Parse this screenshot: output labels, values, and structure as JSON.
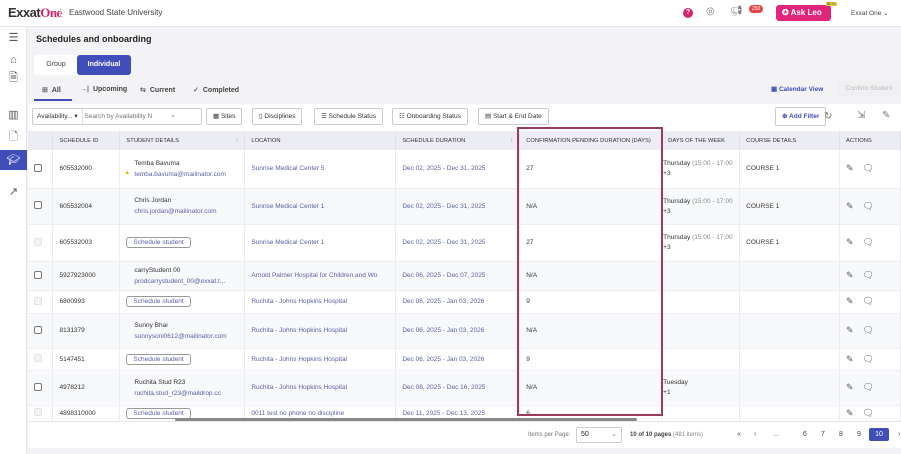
{
  "header": {
    "logo_main": "Exxat",
    "logo_accent": "One",
    "university": "Eastwood State University",
    "notification_count": "250",
    "ask_leo": "Ask Leo",
    "ask_leo_badge": "BETA",
    "user_menu": "Exxat One"
  },
  "sidebar": {
    "items": [
      "menu",
      "home",
      "documents",
      "analytics",
      "files",
      "schedules",
      "reports"
    ],
    "active": "schedules"
  },
  "page": {
    "title": "Schedules and onboarding",
    "toggle": [
      "Group",
      "Individual"
    ],
    "toggle_selected": "Individual",
    "tabs": [
      "All",
      "Upcoming",
      "Current",
      "Completed"
    ],
    "tab_selected": "All",
    "calendar_view": "Calendar View",
    "confirm_student": "Confirm Student"
  },
  "filters": {
    "dropdown": "Availability...",
    "search_placeholder": "Search by Availability N",
    "buttons": [
      "Sites",
      "Disciplines",
      "Schedule Status",
      "Onboarding Status",
      "Start & End Date"
    ],
    "add_filter": "Add Filter"
  },
  "table": {
    "columns": [
      "SCHEDULE ID",
      "STUDENT DETAILS",
      "LOCATION",
      "SCHEDULE DURATION",
      "CONFIRMATION PENDING DURATION (DAYS)",
      "DAYS OF THE WEEK",
      "COURSE DETAILS",
      "ACTIONS"
    ],
    "schedule_button": "Schedule student",
    "rows": [
      {
        "id": "605532000",
        "name": "Temba Bavuma",
        "email": "temba.bavuma@mailinator.com",
        "warning": true,
        "location": "Sunrise Medical Center 5",
        "duration": "Dec 02, 2025 - Dec 31, 2025",
        "pending": "27",
        "days": "Thursday",
        "time": "(15:00 - 17:00",
        "more": "+3",
        "course": "COURSE 1"
      },
      {
        "id": "605532004",
        "name": "Chris Jordan",
        "email": "chris.jordan@mailinator.com",
        "location": "Sunrise Medical Center 1",
        "duration": "Dec 02, 2025 - Dec 31, 2025",
        "pending": "N/A",
        "days": "Thursday",
        "time": "(15:00 - 17:00",
        "more": "+3",
        "course": "COURSE 1"
      },
      {
        "id": "605532003",
        "unscheduled": true,
        "location": "Sunrise Medical Center 1",
        "duration": "Dec 02, 2025 - Dec 31, 2025",
        "pending": "27",
        "days": "Thursday",
        "time": "(15:00 - 17:00",
        "more": "+3",
        "course": "COURSE 1"
      },
      {
        "id": "5927923000",
        "name": "carryStudent 00",
        "email": "prodcarrystudent_00@exxat.t...",
        "location": "Arnold Palmer Hospital for Children and Wo",
        "duration": "Dec 06, 2025 - Dec 07, 2025",
        "pending": "N/A"
      },
      {
        "id": "6800993",
        "unscheduled": true,
        "location": "Ruchita - Johns Hopkins Hospital",
        "duration": "Dec 06, 2025 - Jan 03, 2026",
        "pending": "9"
      },
      {
        "id": "8131379",
        "name": "Sunny Bhai",
        "email": "sunnysoni0612@mailinator.com",
        "location": "Ruchita - Johns Hopkins Hospital",
        "duration": "Dec 06, 2025 - Jan 03, 2026",
        "pending": "N/A"
      },
      {
        "id": "5147451",
        "unscheduled": true,
        "location": "Ruchita - Johns Hopkins Hospital",
        "duration": "Dec 06, 2025 - Jan 03, 2026",
        "pending": "9"
      },
      {
        "id": "4978212",
        "name": "Ruchita Stud R23",
        "email": "ruchita.stud_r23@maildrop.cc",
        "location": "Ruchita - Johns Hopkins Hospital",
        "duration": "Dec 08, 2025 - Dec 16, 2025",
        "pending": "N/A",
        "days": "Tuesday",
        "more": "+1"
      },
      {
        "id": "4898310000",
        "unscheduled": true,
        "location": "0011 test no phone no discipline",
        "duration": "Dec 11, 2025 - Dec 13, 2025",
        "pending": "6"
      }
    ]
  },
  "pagination": {
    "items_per_page_label": "Items per Page:",
    "items_per_page": "50",
    "summary": "10 of 10 pages",
    "total": "(481 items)",
    "pages": [
      "...",
      "6",
      "7",
      "8",
      "9",
      "10"
    ],
    "current": "10"
  },
  "colors": {
    "primary": "#3f4eb8",
    "accent": "#d4246e",
    "highlight": "#9b3a5e"
  }
}
